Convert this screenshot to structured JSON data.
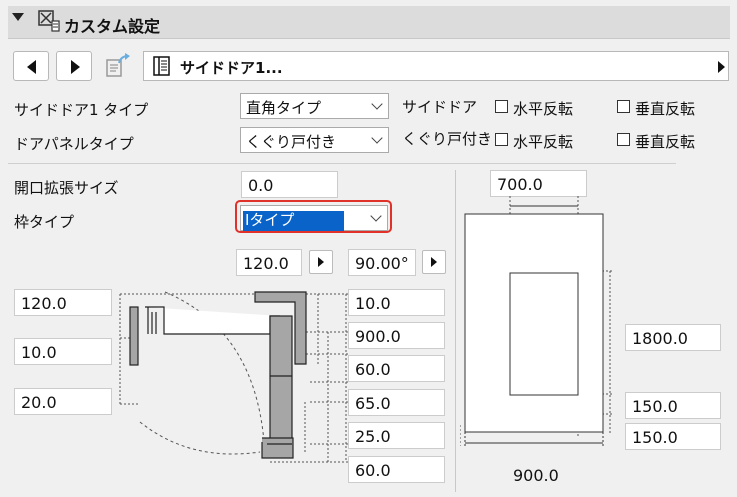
{
  "header": {
    "title": "カスタム設定"
  },
  "nav": {
    "path_label": "サイドドア1..."
  },
  "settings": {
    "door_type_label": "サイドドア1 タイプ",
    "door_type_value": "直角タイプ",
    "panel_type_label": "ドアパネルタイプ",
    "panel_type_value": "くぐり戸付き",
    "side_door_label": "サイドドア",
    "wicket_label": "くぐり戸付き",
    "flip_h": "水平反転",
    "flip_v": "垂直反転"
  },
  "frame": {
    "opening_label": "開口拡張サイズ",
    "opening_value": "0.0",
    "frame_type_label": "枠タイプ",
    "frame_type_value": "Iタイプ"
  },
  "section": {
    "top_width": "120.0",
    "angle": "90.00°",
    "left": [
      "120.0",
      "10.0",
      "20.0"
    ],
    "right": [
      "10.0",
      "900.0",
      "60.0",
      "65.0",
      "25.0",
      "60.0"
    ]
  },
  "elevation": {
    "top_width": "700.0",
    "height": "1800.0",
    "gap1": "150.0",
    "gap2": "150.0",
    "bottom_width": "900.0"
  }
}
